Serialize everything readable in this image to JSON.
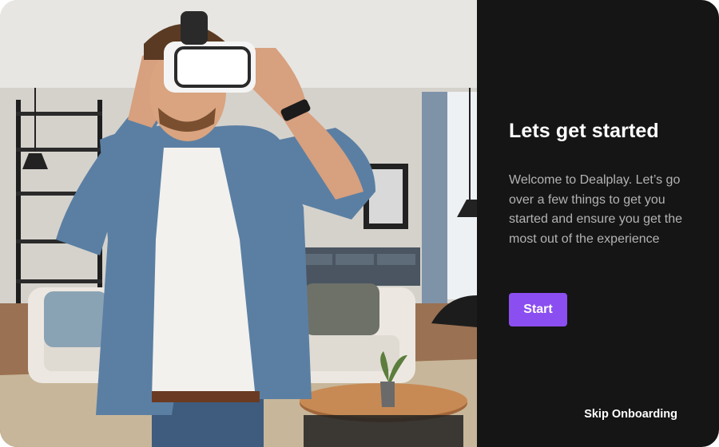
{
  "hero": {
    "image_subject": "man-wearing-vr-headset-in-living-room"
  },
  "onboarding": {
    "title": "Lets get started",
    "description": "Welcome to Dealplay. Let’s go over a few things to get you started and ensure you get the most out of the experience",
    "start_label": "Start",
    "skip_label": "Skip Onboarding"
  },
  "colors": {
    "panel_background": "#151515",
    "accent": "#8b4ef0",
    "title_text": "#ffffff",
    "body_text": "#b3b3b3"
  }
}
